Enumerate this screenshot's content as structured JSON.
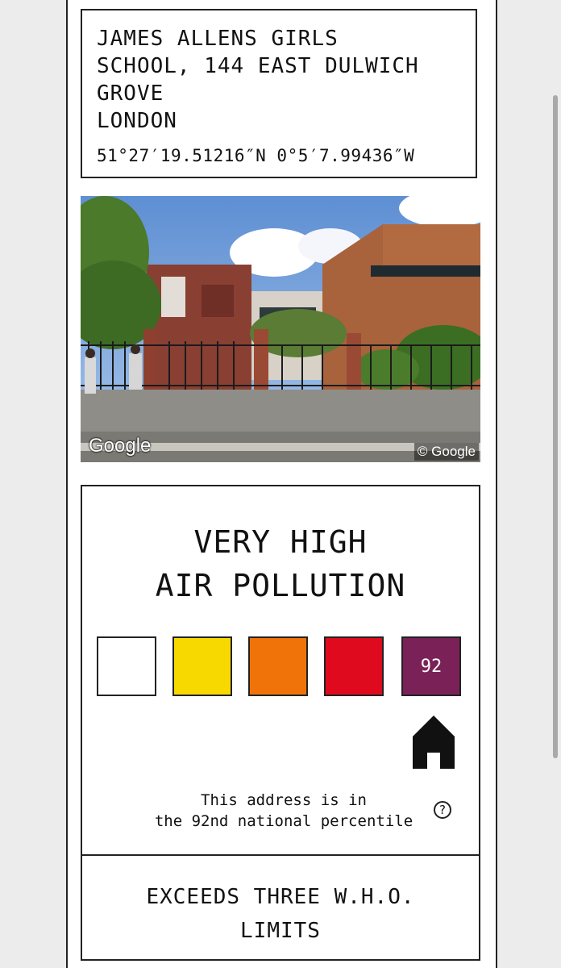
{
  "address": {
    "lines": [
      "JAMES ALLENS GIRLS",
      "SCHOOL, 144 EAST DULWICH",
      "GROVE",
      "LONDON"
    ],
    "coordinates": "51°27′19.51216″N 0°5′7.99436″W"
  },
  "streetview": {
    "watermark": "Google",
    "copyright": "© Google"
  },
  "pollution": {
    "level_lines": [
      "VERY HIGH",
      "AIR POLLUTION"
    ],
    "scale": [
      {
        "color": "#ffffff",
        "label": ""
      },
      {
        "color": "#f7d900",
        "label": ""
      },
      {
        "color": "#ef7308",
        "label": ""
      },
      {
        "color": "#e00a1e",
        "label": ""
      },
      {
        "color": "#7a2158",
        "label": "92"
      }
    ],
    "active_index": 4,
    "percentile_lines": [
      "This address is in",
      "the 92nd national percentile"
    ],
    "help_glyph": "?",
    "home_icon": "home-icon"
  },
  "who": {
    "lines": [
      "EXCEEDS THREE W.H.O.",
      "LIMITS"
    ]
  }
}
